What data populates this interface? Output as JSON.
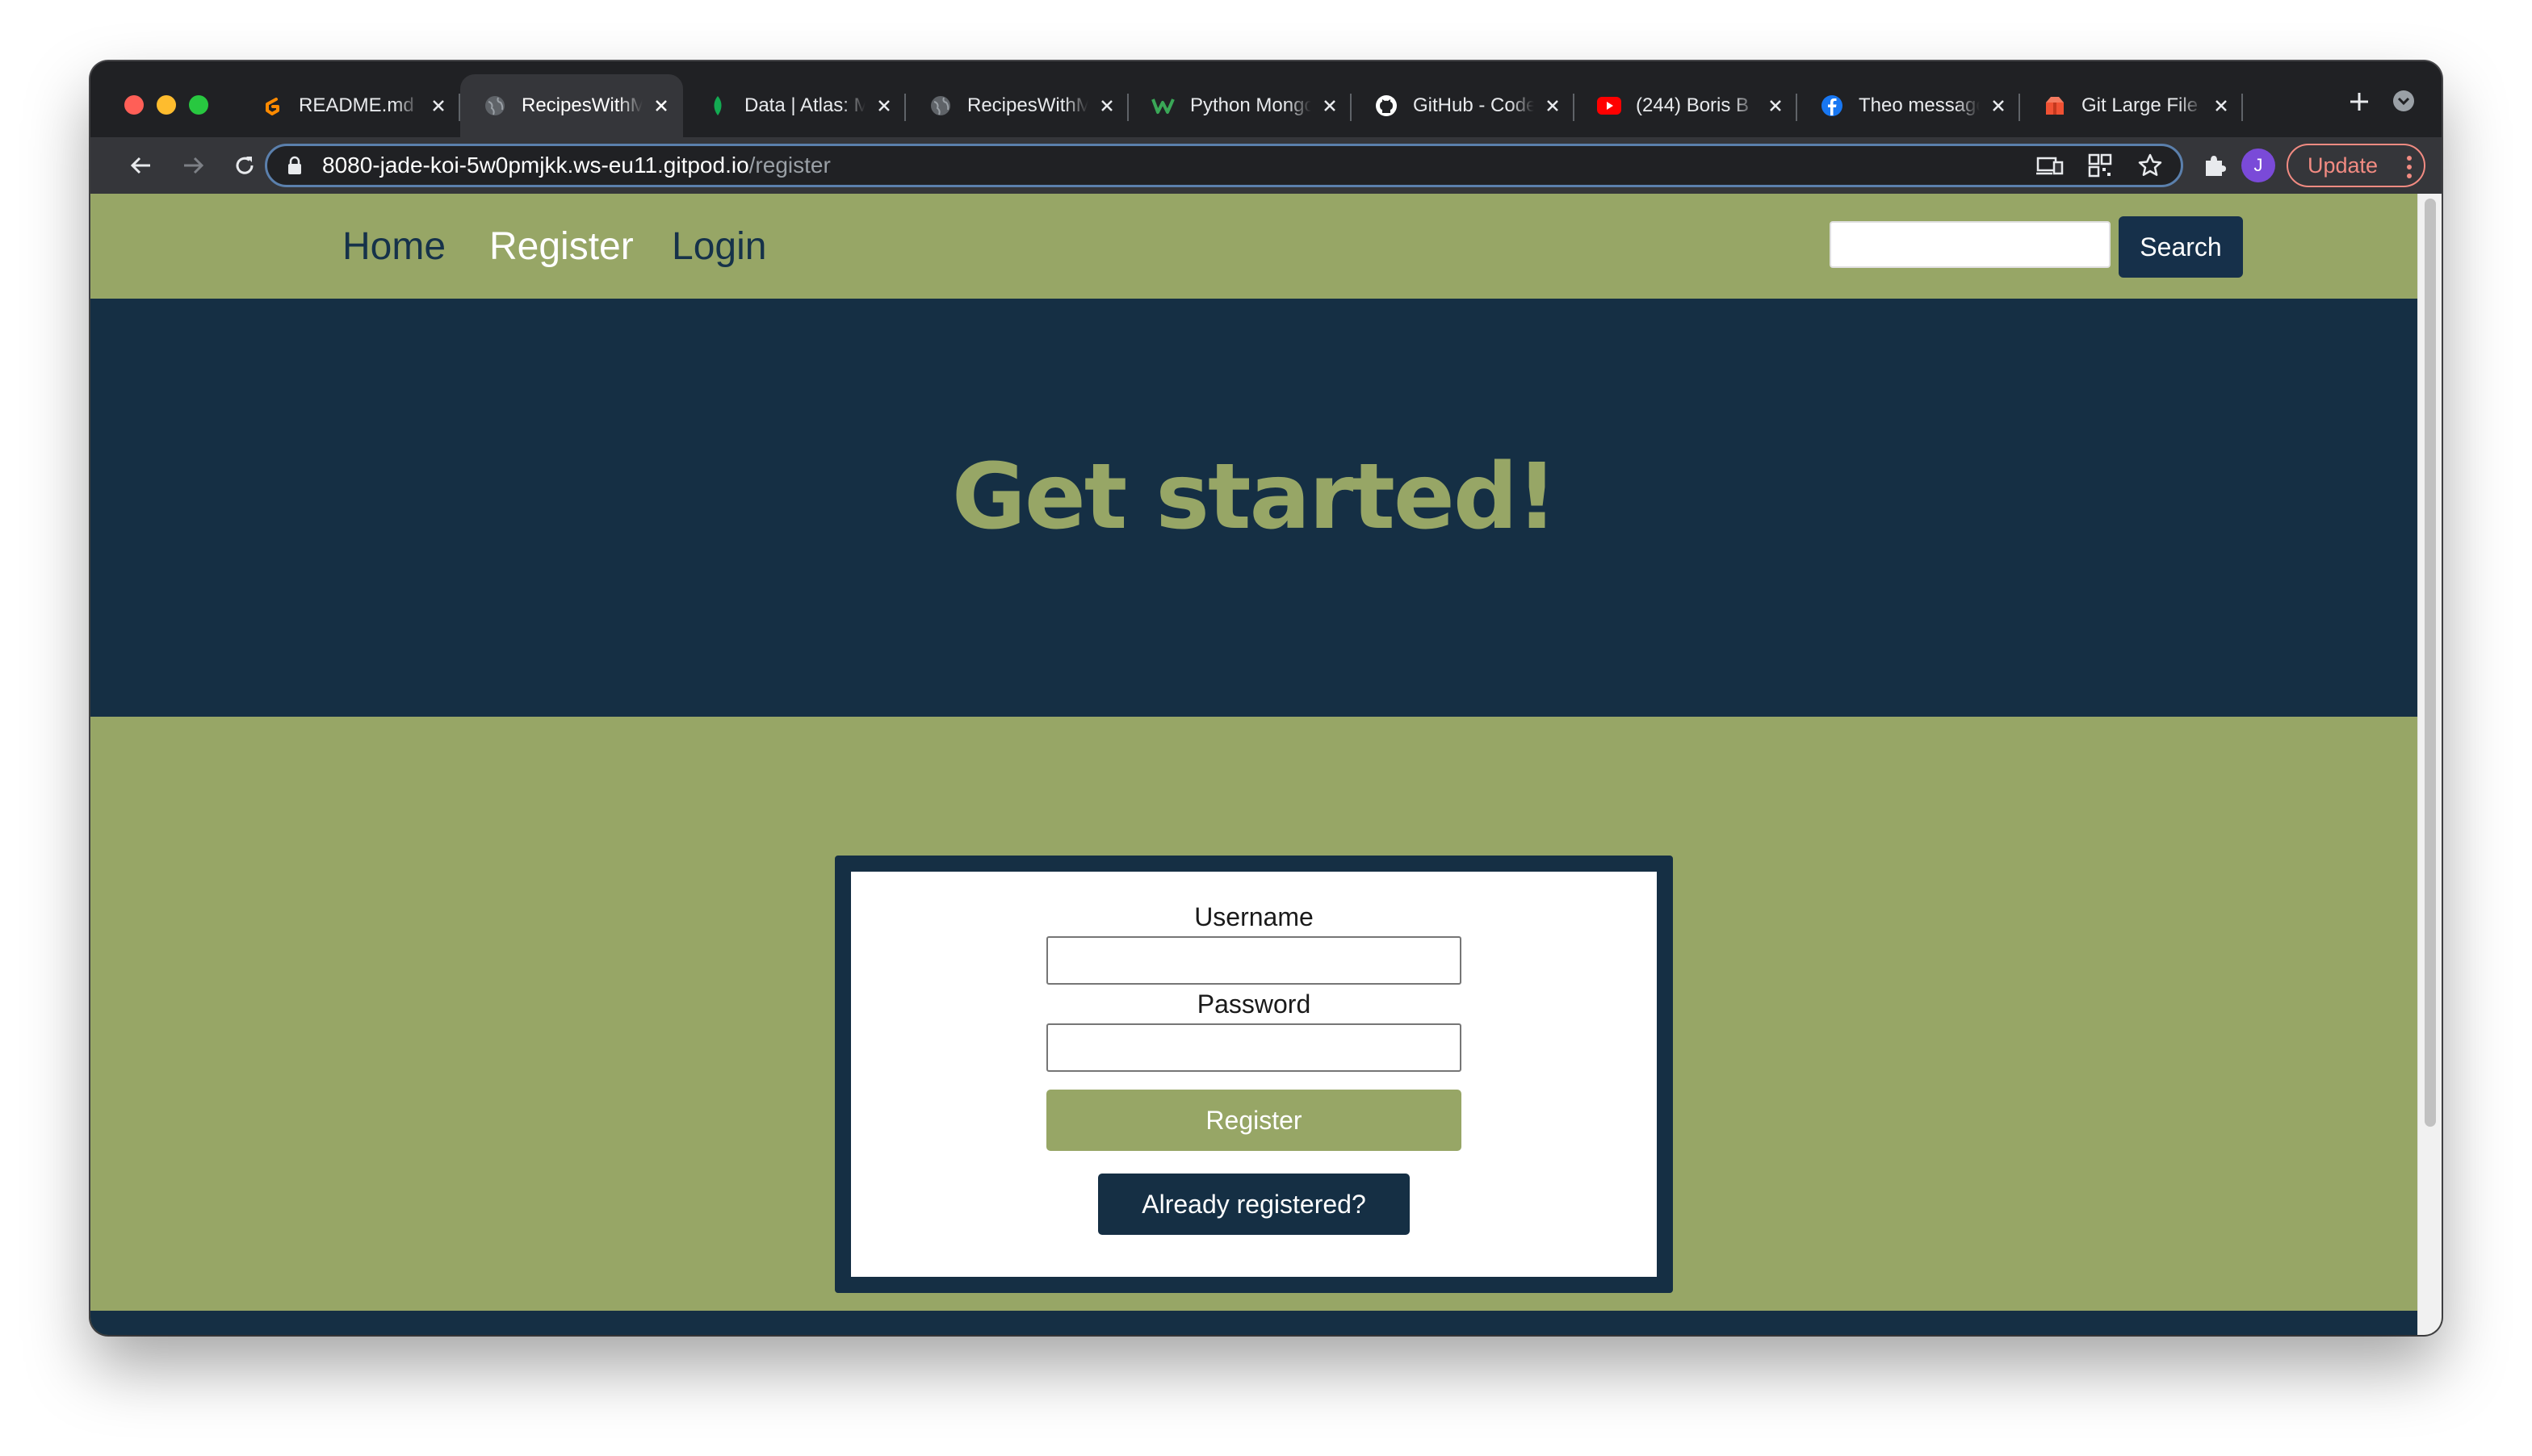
{
  "browser": {
    "tabs": [
      {
        "title": "README.md",
        "icon": "gitpod-icon",
        "active": false
      },
      {
        "title": "RecipesWithM",
        "icon": "globe-icon",
        "active": true
      },
      {
        "title": "Data | Atlas: M",
        "icon": "mongodb-leaf-icon",
        "active": false
      },
      {
        "title": "RecipesWithM",
        "icon": "globe-icon",
        "active": false
      },
      {
        "title": "Python Mongo",
        "icon": "w-logo-icon",
        "active": false
      },
      {
        "title": "GitHub - Code",
        "icon": "github-icon",
        "active": false
      },
      {
        "title": "(244) Boris B",
        "icon": "youtube-icon",
        "active": false
      },
      {
        "title": "Theo message",
        "icon": "facebook-icon",
        "active": false
      },
      {
        "title": "Git Large File",
        "icon": "git-lfs-icon",
        "active": false
      }
    ],
    "address": {
      "host": "8080-jade-koi-5w0pmjkk.ws-eu11.gitpod.io",
      "path": "/register"
    },
    "profile_initial": "J",
    "update_label": "Update"
  },
  "site": {
    "nav": {
      "home": "Home",
      "register": "Register",
      "login": "Login",
      "search_placeholder": "",
      "search_button": "Search"
    },
    "hero_title": "Get started!",
    "form": {
      "username_label": "Username",
      "password_label": "Password",
      "register_button": "Register",
      "already_button": "Already registered?"
    }
  },
  "colors": {
    "olive": "#97a666",
    "navy": "#152f44",
    "white": "#ffffff"
  }
}
